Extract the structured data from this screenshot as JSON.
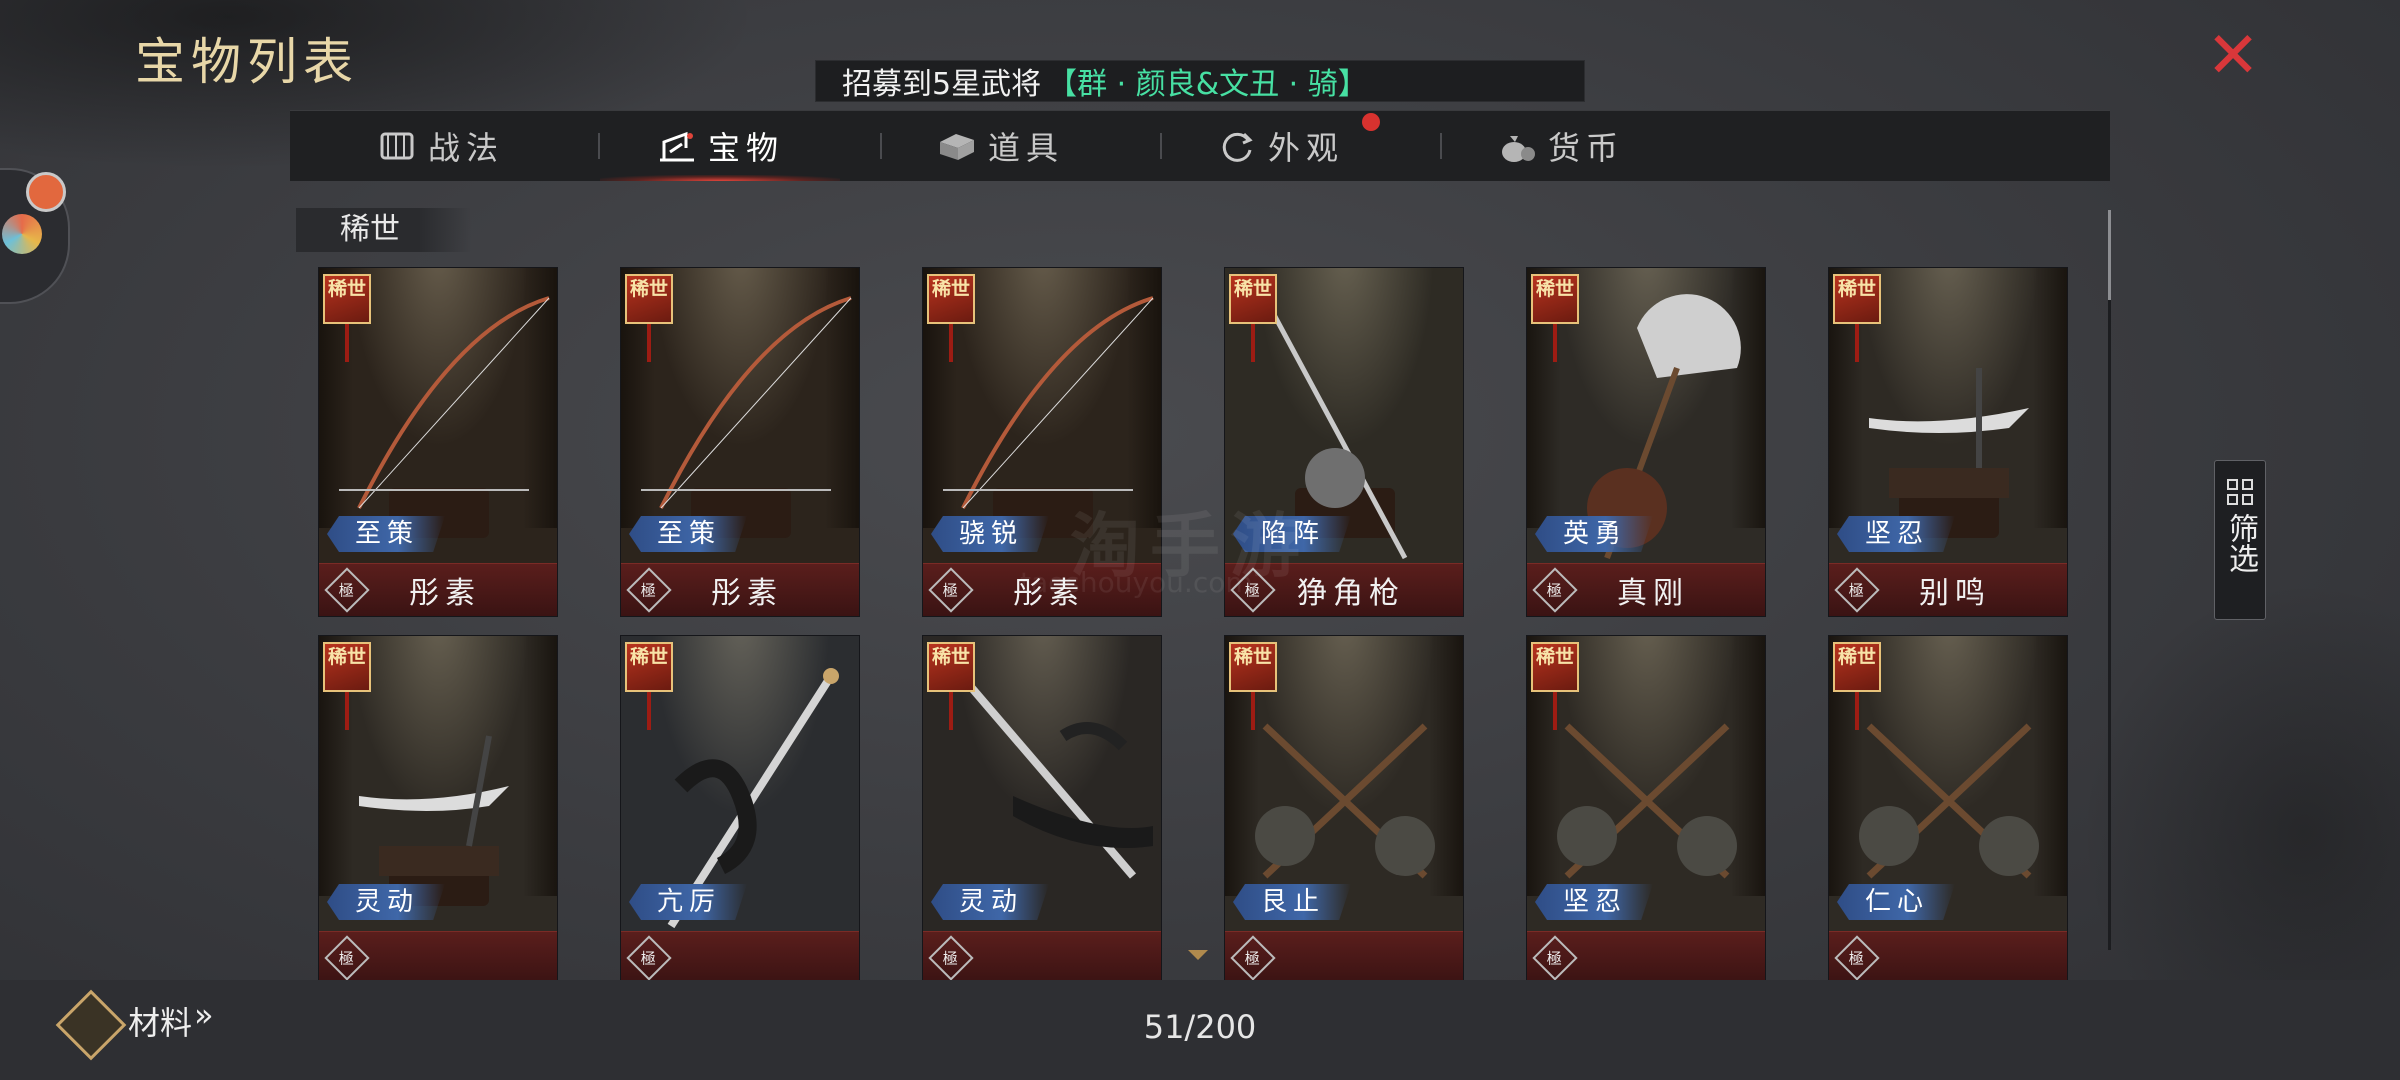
{
  "header": {
    "title": "宝物列表",
    "ticker_text": "招募到5星武将",
    "ticker_highlight": "【群 · 颜良&文丑 · 骑】"
  },
  "tabs": [
    {
      "label": "战法",
      "icon": "scroll-icon"
    },
    {
      "label": "宝物",
      "icon": "treasure-icon",
      "active": true
    },
    {
      "label": "道具",
      "icon": "box-icon"
    },
    {
      "label": "外观",
      "icon": "refresh-icon",
      "notify": true
    },
    {
      "label": "货币",
      "icon": "money-bag-icon"
    }
  ],
  "section": {
    "title": "稀世"
  },
  "rare_badge": "稀世",
  "grade_label": "極",
  "cards": [
    {
      "skill": "至策",
      "name": "彤素"
    },
    {
      "skill": "至策",
      "name": "彤素"
    },
    {
      "skill": "骁锐",
      "name": "彤素"
    },
    {
      "skill": "陷阵",
      "name": "狰角枪"
    },
    {
      "skill": "英勇",
      "name": "真刚"
    },
    {
      "skill": "坚忍",
      "name": "别鸣"
    },
    {
      "skill": "灵动",
      "name": ""
    },
    {
      "skill": "亢厉",
      "name": ""
    },
    {
      "skill": "灵动",
      "name": ""
    },
    {
      "skill": "艮止",
      "name": ""
    },
    {
      "skill": "坚忍",
      "name": ""
    },
    {
      "skill": "仁心",
      "name": ""
    }
  ],
  "filter": {
    "label": "筛选"
  },
  "footer": {
    "materials_label": "材料",
    "materials_chevron": "»",
    "count": "51/200"
  },
  "watermark": {
    "text": "淘手游",
    "sub": "taoshouyou.com"
  },
  "colors": {
    "accent_red": "#d9373a",
    "ticker_green": "#47e0a3",
    "title_gold": "#e8d7a8",
    "tag_blue": "#3f67a8"
  }
}
